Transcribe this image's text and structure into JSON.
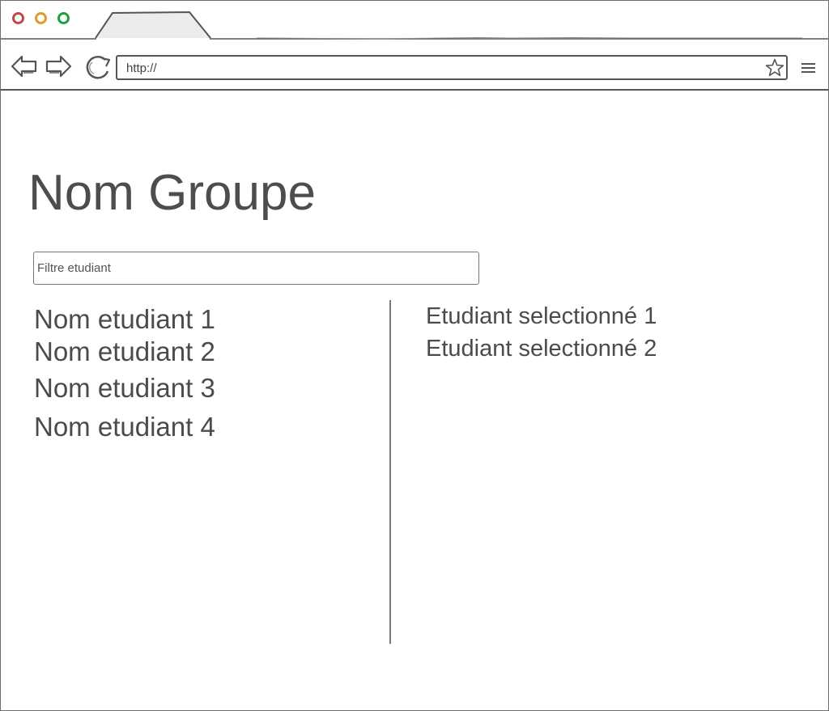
{
  "browser": {
    "url": "http://",
    "icons": {
      "back": "back-arrow-icon",
      "forward": "forward-arrow-icon",
      "reload": "reload-icon",
      "bookmark": "star-icon",
      "menu": "hamburger-menu-icon"
    },
    "window_dots": [
      "#c0494b",
      "#e09a2c",
      "#1aa33c"
    ]
  },
  "page": {
    "title": "Nom Groupe",
    "filter": {
      "placeholder": "Filtre etudiant",
      "value": ""
    },
    "students": [
      {
        "label": "Nom etudiant 1"
      },
      {
        "label": "Nom etudiant 2"
      },
      {
        "label": "Nom etudiant 3"
      },
      {
        "label": "Nom etudiant 4"
      }
    ],
    "selected_students": [
      {
        "label": "Etudiant selectionné 1"
      },
      {
        "label": "Etudiant selectionné 2"
      }
    ]
  }
}
